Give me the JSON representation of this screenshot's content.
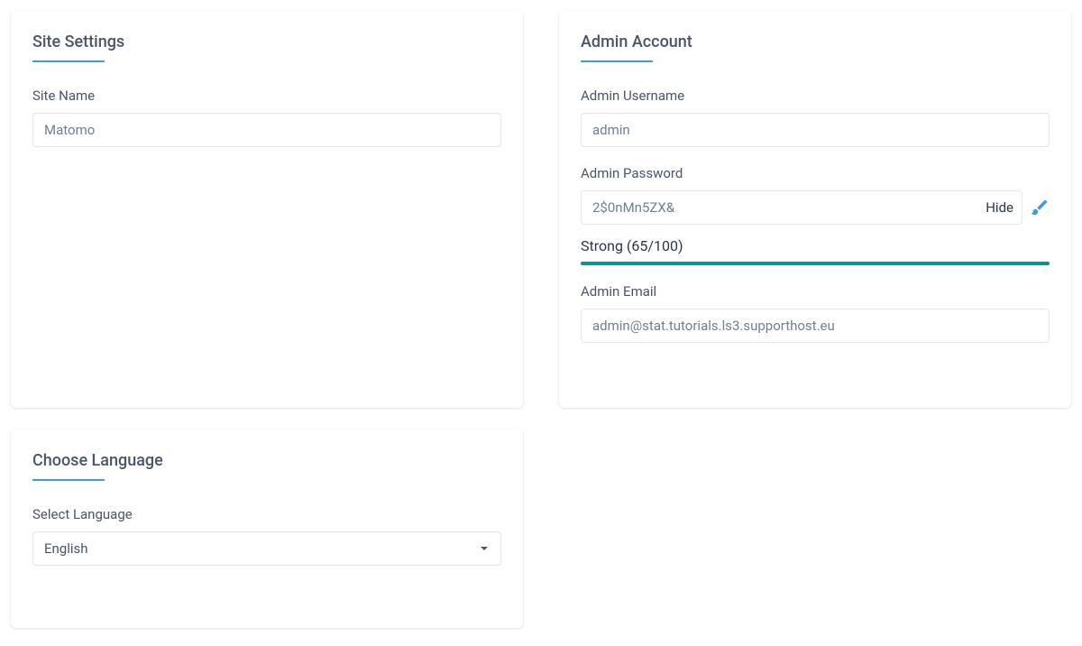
{
  "siteSettings": {
    "title": "Site Settings",
    "siteNameLabel": "Site Name",
    "siteNameValue": "Matomo"
  },
  "chooseLanguage": {
    "title": "Choose Language",
    "selectLabel": "Select Language",
    "selectedValue": "English"
  },
  "adminAccount": {
    "title": "Admin Account",
    "usernameLabel": "Admin Username",
    "usernameValue": "admin",
    "passwordLabel": "Admin Password",
    "passwordValue": "2$0nMn5ZX&",
    "hideToggle": "Hide",
    "strengthLabel": "Strong (65/100)",
    "strengthPercent": 100,
    "emailLabel": "Admin Email",
    "emailValue": "admin@stat.tutorials.ls3.supporthost.eu"
  },
  "colors": {
    "accent": "#4299e1",
    "strength": "#0d9488"
  }
}
